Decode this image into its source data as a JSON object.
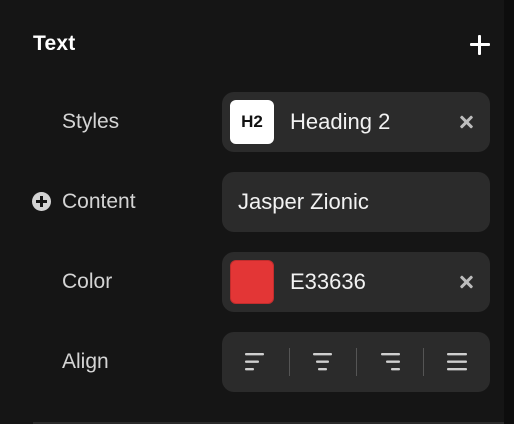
{
  "section": {
    "title": "Text",
    "add_icon": "plus-icon"
  },
  "rows": {
    "styles": {
      "label": "Styles",
      "badge": "H2",
      "value": "Heading 2",
      "clear_icon": "close-icon"
    },
    "content": {
      "label": "Content",
      "value": "Jasper Zionic",
      "add_icon": "plus-circle-icon"
    },
    "color": {
      "label": "Color",
      "value": "E33636",
      "swatch_color": "#E33636",
      "clear_icon": "close-icon"
    },
    "align": {
      "label": "Align",
      "options": [
        {
          "icon": "align-left-icon"
        },
        {
          "icon": "align-center-icon"
        },
        {
          "icon": "align-right-icon"
        },
        {
          "icon": "align-justify-icon"
        }
      ]
    }
  },
  "colors": {
    "panel_bg": "#151515",
    "field_bg": "#2b2b2b",
    "label_text": "#d4d4d4",
    "accent": "#E33636"
  }
}
